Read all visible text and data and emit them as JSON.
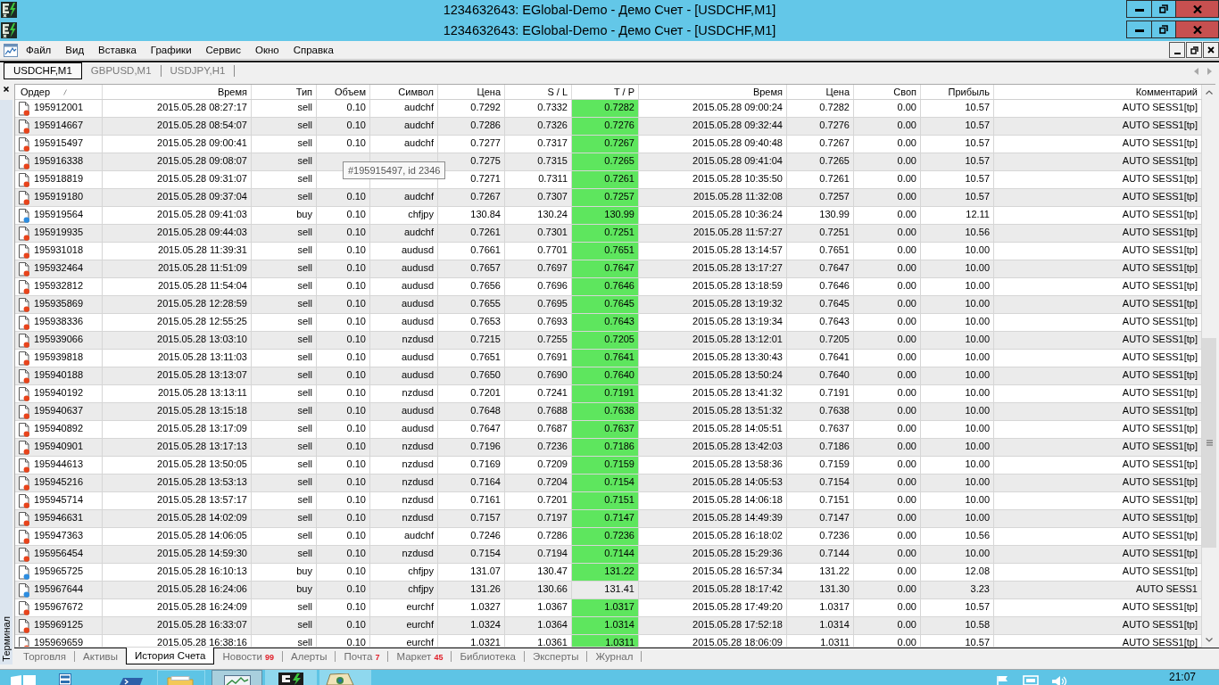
{
  "title_bars": [
    {
      "title": "1234632643: EGlobal-Demo - Демо Счет - [USDCHF,M1]"
    },
    {
      "title": "1234632643: EGlobal-Demo - Демо Счет - [USDCHF,M1]"
    }
  ],
  "menu_bar": {
    "items": [
      "Файл",
      "Вид",
      "Вставка",
      "Графики",
      "Сервис",
      "Окно",
      "Справка"
    ]
  },
  "chart_tabs": [
    {
      "label": "USDCHF,M1",
      "selected": true
    },
    {
      "label": "GBPUSD,M1",
      "selected": false
    },
    {
      "label": "USDJPY,H1",
      "selected": false
    }
  ],
  "terminal": {
    "label": "Терминал",
    "columns": [
      {
        "label": "Ордер",
        "sorted": true
      },
      {
        "label": "Время",
        "sorted": false
      },
      {
        "label": "Тип",
        "sorted": false
      },
      {
        "label": "Объем",
        "sorted": false
      },
      {
        "label": "Символ",
        "sorted": false
      },
      {
        "label": "Цена",
        "sorted": false
      },
      {
        "label": "S / L",
        "sorted": false
      },
      {
        "label": "T / P",
        "sorted": false
      },
      {
        "label": "Время",
        "sorted": false
      },
      {
        "label": "Цена",
        "sorted": false
      },
      {
        "label": "Своп",
        "sorted": false
      },
      {
        "label": "Прибыль",
        "sorted": false
      },
      {
        "label": "Комментарий",
        "sorted": false
      }
    ],
    "rows": [
      {
        "kind": "sell",
        "tp_hit": true,
        "cells": [
          "195912001",
          "2015.05.28 08:27:17",
          "sell",
          "0.10",
          "audchf",
          "0.7292",
          "0.7332",
          "0.7282",
          "2015.05.28 09:00:24",
          "0.7282",
          "0.00",
          "10.57",
          "AUTO SESS1[tp]"
        ]
      },
      {
        "kind": "sell",
        "tp_hit": true,
        "cells": [
          "195914667",
          "2015.05.28 08:54:07",
          "sell",
          "0.10",
          "audchf",
          "0.7286",
          "0.7326",
          "0.7276",
          "2015.05.28 09:32:44",
          "0.7276",
          "0.00",
          "10.57",
          "AUTO SESS1[tp]"
        ]
      },
      {
        "kind": "sell",
        "tp_hit": true,
        "cells": [
          "195915497",
          "2015.05.28 09:00:41",
          "sell",
          "0.10",
          "audchf",
          "0.7277",
          "0.7317",
          "0.7267",
          "2015.05.28 09:40:48",
          "0.7267",
          "0.00",
          "10.57",
          "AUTO SESS1[tp]"
        ]
      },
      {
        "kind": "sell",
        "tp_hit": true,
        "cells": [
          "195916338",
          "2015.05.28 09:08:07",
          "sell",
          null,
          null,
          "0.7275",
          "0.7315",
          "0.7265",
          "2015.05.28 09:41:04",
          "0.7265",
          "0.00",
          "10.57",
          "AUTO SESS1[tp]"
        ]
      },
      {
        "kind": "sell",
        "tp_hit": true,
        "cells": [
          "195918819",
          "2015.05.28 09:31:07",
          "sell",
          null,
          null,
          "0.7271",
          "0.7311",
          "0.7261",
          "2015.05.28 10:35:50",
          "0.7261",
          "0.00",
          "10.57",
          "AUTO SESS1[tp]"
        ]
      },
      {
        "kind": "sell",
        "tp_hit": true,
        "cells": [
          "195919180",
          "2015.05.28 09:37:04",
          "sell",
          "0.10",
          "audchf",
          "0.7267",
          "0.7307",
          "0.7257",
          "2015.05.28 11:32:08",
          "0.7257",
          "0.00",
          "10.57",
          "AUTO SESS1[tp]"
        ]
      },
      {
        "kind": "buy",
        "tp_hit": true,
        "cells": [
          "195919564",
          "2015.05.28 09:41:03",
          "buy",
          "0.10",
          "chfjpy",
          "130.84",
          "130.24",
          "130.99",
          "2015.05.28 10:36:24",
          "130.99",
          "0.00",
          "12.11",
          "AUTO SESS1[tp]"
        ]
      },
      {
        "kind": "sell",
        "tp_hit": true,
        "cells": [
          "195919935",
          "2015.05.28 09:44:03",
          "sell",
          "0.10",
          "audchf",
          "0.7261",
          "0.7301",
          "0.7251",
          "2015.05.28 11:57:27",
          "0.7251",
          "0.00",
          "10.56",
          "AUTO SESS1[tp]"
        ]
      },
      {
        "kind": "sell",
        "tp_hit": true,
        "cells": [
          "195931018",
          "2015.05.28 11:39:31",
          "sell",
          "0.10",
          "audusd",
          "0.7661",
          "0.7701",
          "0.7651",
          "2015.05.28 13:14:57",
          "0.7651",
          "0.00",
          "10.00",
          "AUTO SESS1[tp]"
        ]
      },
      {
        "kind": "sell",
        "tp_hit": true,
        "cells": [
          "195932464",
          "2015.05.28 11:51:09",
          "sell",
          "0.10",
          "audusd",
          "0.7657",
          "0.7697",
          "0.7647",
          "2015.05.28 13:17:27",
          "0.7647",
          "0.00",
          "10.00",
          "AUTO SESS1[tp]"
        ]
      },
      {
        "kind": "sell",
        "tp_hit": true,
        "cells": [
          "195932812",
          "2015.05.28 11:54:04",
          "sell",
          "0.10",
          "audusd",
          "0.7656",
          "0.7696",
          "0.7646",
          "2015.05.28 13:18:59",
          "0.7646",
          "0.00",
          "10.00",
          "AUTO SESS1[tp]"
        ]
      },
      {
        "kind": "sell",
        "tp_hit": true,
        "cells": [
          "195935869",
          "2015.05.28 12:28:59",
          "sell",
          "0.10",
          "audusd",
          "0.7655",
          "0.7695",
          "0.7645",
          "2015.05.28 13:19:32",
          "0.7645",
          "0.00",
          "10.00",
          "AUTO SESS1[tp]"
        ]
      },
      {
        "kind": "sell",
        "tp_hit": true,
        "cells": [
          "195938336",
          "2015.05.28 12:55:25",
          "sell",
          "0.10",
          "audusd",
          "0.7653",
          "0.7693",
          "0.7643",
          "2015.05.28 13:19:34",
          "0.7643",
          "0.00",
          "10.00",
          "AUTO SESS1[tp]"
        ]
      },
      {
        "kind": "sell",
        "tp_hit": true,
        "cells": [
          "195939066",
          "2015.05.28 13:03:10",
          "sell",
          "0.10",
          "nzdusd",
          "0.7215",
          "0.7255",
          "0.7205",
          "2015.05.28 13:12:01",
          "0.7205",
          "0.00",
          "10.00",
          "AUTO SESS1[tp]"
        ]
      },
      {
        "kind": "sell",
        "tp_hit": true,
        "cells": [
          "195939818",
          "2015.05.28 13:11:03",
          "sell",
          "0.10",
          "audusd",
          "0.7651",
          "0.7691",
          "0.7641",
          "2015.05.28 13:30:43",
          "0.7641",
          "0.00",
          "10.00",
          "AUTO SESS1[tp]"
        ]
      },
      {
        "kind": "sell",
        "tp_hit": true,
        "cells": [
          "195940188",
          "2015.05.28 13:13:07",
          "sell",
          "0.10",
          "audusd",
          "0.7650",
          "0.7690",
          "0.7640",
          "2015.05.28 13:50:24",
          "0.7640",
          "0.00",
          "10.00",
          "AUTO SESS1[tp]"
        ]
      },
      {
        "kind": "sell",
        "tp_hit": true,
        "cells": [
          "195940192",
          "2015.05.28 13:13:11",
          "sell",
          "0.10",
          "nzdusd",
          "0.7201",
          "0.7241",
          "0.7191",
          "2015.05.28 13:41:32",
          "0.7191",
          "0.00",
          "10.00",
          "AUTO SESS1[tp]"
        ]
      },
      {
        "kind": "sell",
        "tp_hit": true,
        "cells": [
          "195940637",
          "2015.05.28 13:15:18",
          "sell",
          "0.10",
          "audusd",
          "0.7648",
          "0.7688",
          "0.7638",
          "2015.05.28 13:51:32",
          "0.7638",
          "0.00",
          "10.00",
          "AUTO SESS1[tp]"
        ]
      },
      {
        "kind": "sell",
        "tp_hit": true,
        "cells": [
          "195940892",
          "2015.05.28 13:17:09",
          "sell",
          "0.10",
          "audusd",
          "0.7647",
          "0.7687",
          "0.7637",
          "2015.05.28 14:05:51",
          "0.7637",
          "0.00",
          "10.00",
          "AUTO SESS1[tp]"
        ]
      },
      {
        "kind": "sell",
        "tp_hit": true,
        "cells": [
          "195940901",
          "2015.05.28 13:17:13",
          "sell",
          "0.10",
          "nzdusd",
          "0.7196",
          "0.7236",
          "0.7186",
          "2015.05.28 13:42:03",
          "0.7186",
          "0.00",
          "10.00",
          "AUTO SESS1[tp]"
        ]
      },
      {
        "kind": "sell",
        "tp_hit": true,
        "cells": [
          "195944613",
          "2015.05.28 13:50:05",
          "sell",
          "0.10",
          "nzdusd",
          "0.7169",
          "0.7209",
          "0.7159",
          "2015.05.28 13:58:36",
          "0.7159",
          "0.00",
          "10.00",
          "AUTO SESS1[tp]"
        ]
      },
      {
        "kind": "sell",
        "tp_hit": true,
        "cells": [
          "195945216",
          "2015.05.28 13:53:13",
          "sell",
          "0.10",
          "nzdusd",
          "0.7164",
          "0.7204",
          "0.7154",
          "2015.05.28 14:05:53",
          "0.7154",
          "0.00",
          "10.00",
          "AUTO SESS1[tp]"
        ]
      },
      {
        "kind": "sell",
        "tp_hit": true,
        "cells": [
          "195945714",
          "2015.05.28 13:57:17",
          "sell",
          "0.10",
          "nzdusd",
          "0.7161",
          "0.7201",
          "0.7151",
          "2015.05.28 14:06:18",
          "0.7151",
          "0.00",
          "10.00",
          "AUTO SESS1[tp]"
        ]
      },
      {
        "kind": "sell",
        "tp_hit": true,
        "cells": [
          "195946631",
          "2015.05.28 14:02:09",
          "sell",
          "0.10",
          "nzdusd",
          "0.7157",
          "0.7197",
          "0.7147",
          "2015.05.28 14:49:39",
          "0.7147",
          "0.00",
          "10.00",
          "AUTO SESS1[tp]"
        ]
      },
      {
        "kind": "sell",
        "tp_hit": true,
        "cells": [
          "195947363",
          "2015.05.28 14:06:05",
          "sell",
          "0.10",
          "audchf",
          "0.7246",
          "0.7286",
          "0.7236",
          "2015.05.28 16:18:02",
          "0.7236",
          "0.00",
          "10.56",
          "AUTO SESS1[tp]"
        ]
      },
      {
        "kind": "sell",
        "tp_hit": true,
        "cells": [
          "195956454",
          "2015.05.28 14:59:30",
          "sell",
          "0.10",
          "nzdusd",
          "0.7154",
          "0.7194",
          "0.7144",
          "2015.05.28 15:29:36",
          "0.7144",
          "0.00",
          "10.00",
          "AUTO SESS1[tp]"
        ]
      },
      {
        "kind": "buy",
        "tp_hit": true,
        "cells": [
          "195965725",
          "2015.05.28 16:10:13",
          "buy",
          "0.10",
          "chfjpy",
          "131.07",
          "130.47",
          "131.22",
          "2015.05.28 16:57:34",
          "131.22",
          "0.00",
          "12.08",
          "AUTO SESS1[tp]"
        ]
      },
      {
        "kind": "buy",
        "tp_hit": false,
        "cells": [
          "195967644",
          "2015.05.28 16:24:06",
          "buy",
          "0.10",
          "chfjpy",
          "131.26",
          "130.66",
          "131.41",
          "2015.05.28 18:17:42",
          "131.30",
          "0.00",
          "3.23",
          "AUTO SESS1"
        ]
      },
      {
        "kind": "sell",
        "tp_hit": true,
        "cells": [
          "195967672",
          "2015.05.28 16:24:09",
          "sell",
          "0.10",
          "eurchf",
          "1.0327",
          "1.0367",
          "1.0317",
          "2015.05.28 17:49:20",
          "1.0317",
          "0.00",
          "10.57",
          "AUTO SESS1[tp]"
        ]
      },
      {
        "kind": "sell",
        "tp_hit": true,
        "cells": [
          "195969125",
          "2015.05.28 16:33:07",
          "sell",
          "0.10",
          "eurchf",
          "1.0324",
          "1.0364",
          "1.0314",
          "2015.05.28 17:52:18",
          "1.0314",
          "0.00",
          "10.58",
          "AUTO SESS1[tp]"
        ]
      },
      {
        "kind": "sell",
        "tp_hit": true,
        "cells": [
          "195969659",
          "2015.05.28 16:38:16",
          "sell",
          "0.10",
          "eurchf",
          "1.0321",
          "1.0361",
          "1.0311",
          "2015.05.28 18:06:09",
          "1.0311",
          "0.00",
          "10.57",
          "AUTO SESS1[tp]"
        ]
      }
    ],
    "tooltip": "#195915497, id 2346",
    "tabs": [
      {
        "label": "Торговля",
        "selected": false
      },
      {
        "label": "Активы",
        "selected": false
      },
      {
        "label": "История Счета",
        "selected": true
      },
      {
        "label": "Новости",
        "badge": "99",
        "selected": false
      },
      {
        "label": "Алерты",
        "selected": false
      },
      {
        "label": "Почта",
        "badge": "7",
        "selected": false
      },
      {
        "label": "Маркет",
        "badge": "45",
        "selected": false
      },
      {
        "label": "Библиотека",
        "selected": false
      },
      {
        "label": "Эксперты",
        "selected": false
      },
      {
        "label": "Журнал",
        "selected": false
      }
    ]
  },
  "taskbar": {
    "clock": "21:07"
  }
}
